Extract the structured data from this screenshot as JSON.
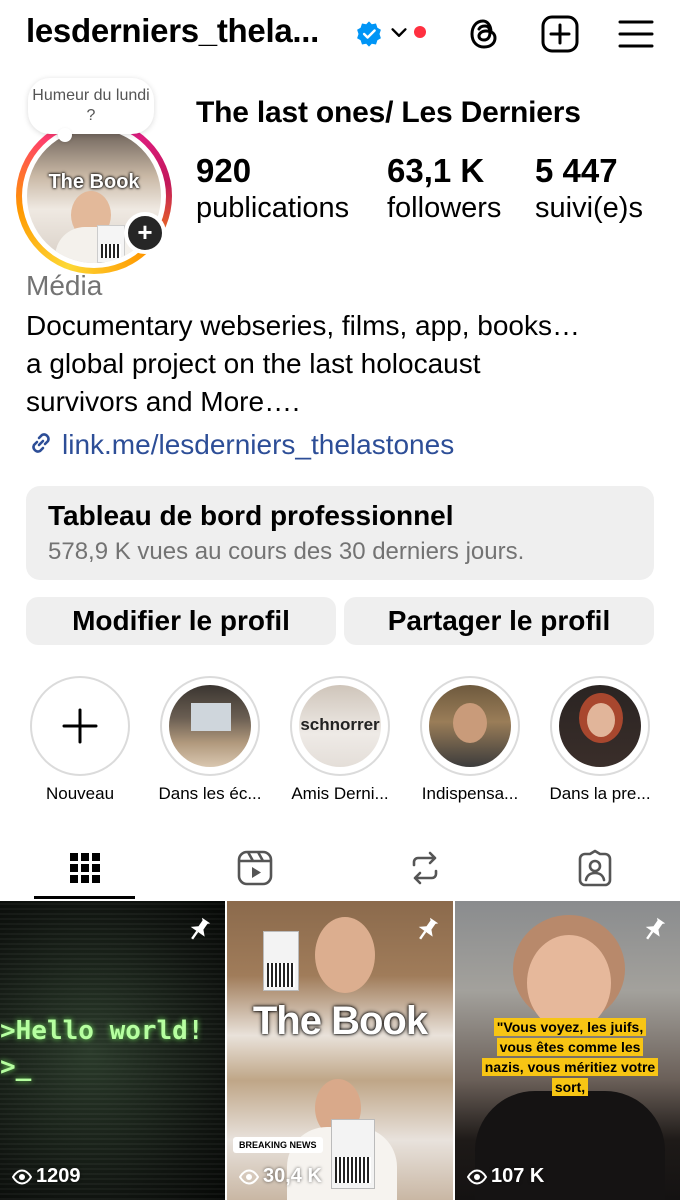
{
  "header": {
    "username": "lesderniers_thela...",
    "verified_color": "#0095f6",
    "notification_dot_color": "#ff3040",
    "icons": [
      "threads-icon",
      "create-icon",
      "menu-icon"
    ]
  },
  "profile": {
    "note": "Humeur du lundi ?",
    "avatar_overlay_text": "The Book",
    "display_name": "The last ones/ Les Derniers",
    "stats": [
      {
        "value": "920",
        "label": "publications"
      },
      {
        "value": "63,1 K",
        "label": "followers"
      },
      {
        "value": "5 447",
        "label": "suivi(e)s"
      }
    ],
    "category": "Média",
    "bio_lines": [
      "Documentary webseries, films, app, books…",
      "a global project on the last holocaust",
      "survivors and More…."
    ],
    "link": "link.me/lesderniers_thelastones",
    "link_color": "#2d4e97"
  },
  "dashboard": {
    "title": "Tableau de bord professionnel",
    "subtitle": "578,9 K vues au cours des 30 derniers jours."
  },
  "buttons": {
    "edit": "Modifier le profil",
    "share": "Partager le profil"
  },
  "highlights": [
    {
      "label": "Nouveau"
    },
    {
      "label": "Dans les éc..."
    },
    {
      "label": "Amis Derni..."
    },
    {
      "label": "Indispensa..."
    },
    {
      "label": "Dans la pre..."
    }
  ],
  "tabs": [
    "grid-icon",
    "reels-icon",
    "reposts-icon",
    "tagged-icon"
  ],
  "grid": [
    {
      "text": ">Hello world!\n>_",
      "views": "1209",
      "pinned": true
    },
    {
      "text": "The Book",
      "badge": "BREAKING NEWS",
      "views": "30,4 K",
      "pinned": true
    },
    {
      "text": "\"Vous voyez, les juifs, vous êtes comme les nazis, vous méritiez votre sort,",
      "views": "107 K",
      "pinned": true
    }
  ]
}
